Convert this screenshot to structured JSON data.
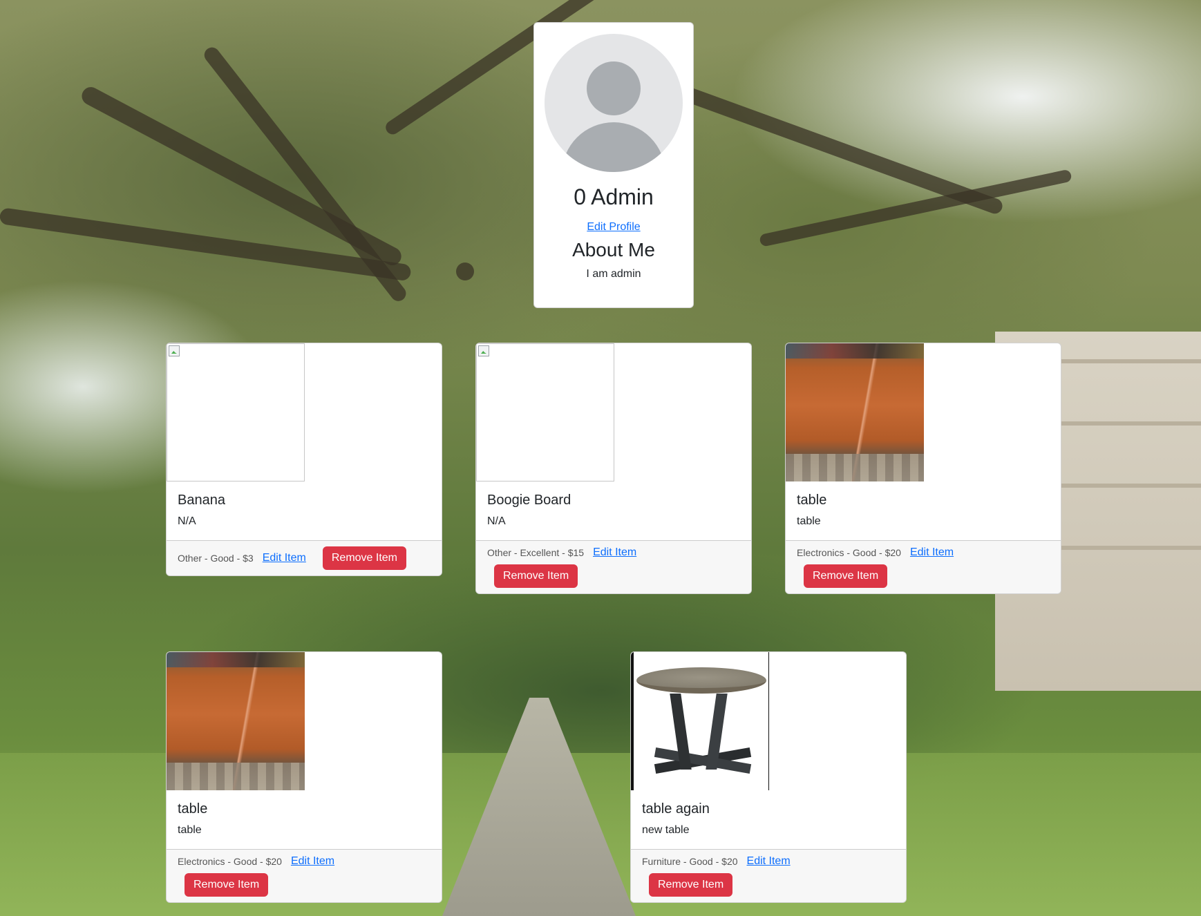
{
  "profile": {
    "name": "0 Admin",
    "edit_profile_label": "Edit Profile",
    "about_title": "About Me",
    "about_text": "I am admin"
  },
  "items": [
    {
      "title": "Banana",
      "description": "N/A",
      "meta": "Other - Good - $3",
      "edit_label": "Edit Item",
      "remove_label": "Remove Item",
      "image": "broken"
    },
    {
      "title": "Boogie Board",
      "description": "N/A",
      "meta": "Other - Excellent - $15",
      "edit_label": "Edit Item",
      "remove_label": "Remove Item",
      "image": "broken"
    },
    {
      "title": "table",
      "description": "table",
      "meta": "Electronics - Good - $20",
      "edit_label": "Edit Item",
      "remove_label": "Remove Item",
      "image": "wooden-table-photo"
    },
    {
      "title": "table",
      "description": "table",
      "meta": "Electronics - Good - $20",
      "edit_label": "Edit Item",
      "remove_label": "Remove Item",
      "image": "wooden-table-photo"
    },
    {
      "title": "table again",
      "description": "new table",
      "meta": "Furniture - Good - $20",
      "edit_label": "Edit Item",
      "remove_label": "Remove Item",
      "image": "round-table-photo"
    }
  ],
  "colors": {
    "link": "#0d6efd",
    "danger": "#dc3545"
  }
}
